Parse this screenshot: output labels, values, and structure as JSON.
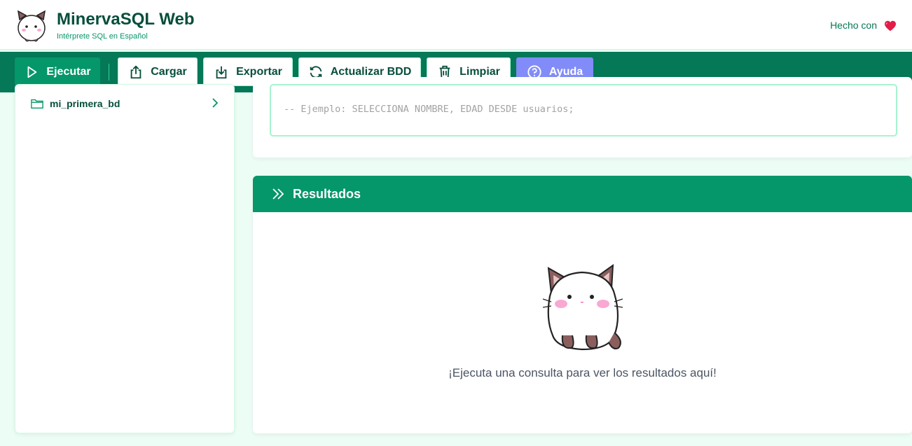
{
  "header": {
    "title": "MinervaSQL Web",
    "subtitle": "Intérprete SQL en Español",
    "made_with": "Hecho con",
    "logo_icon": "cat-logo-icon",
    "heart_icon": "heart-icon"
  },
  "toolbar": {
    "run_label": "Ejecutar",
    "load_label": "Cargar",
    "export_label": "Exportar",
    "refresh_label": "Actualizar BDD",
    "clear_label": "Limpiar",
    "help_label": "Ayuda"
  },
  "sidebar": {
    "databases": [
      {
        "name": "mi_primera_bd",
        "icon": "folder-icon"
      }
    ]
  },
  "editor": {
    "placeholder": "-- Ejemplo: SELECCIONA NOMBRE, EDAD DESDE usuarios;"
  },
  "results": {
    "title": "Resultados",
    "empty_message": "¡Ejecuta una consulta para ver los resultados aquí!"
  },
  "colors": {
    "primary": "#047857",
    "accent": "#059669",
    "help": "#818cf8",
    "background": "#ecfdf5"
  }
}
